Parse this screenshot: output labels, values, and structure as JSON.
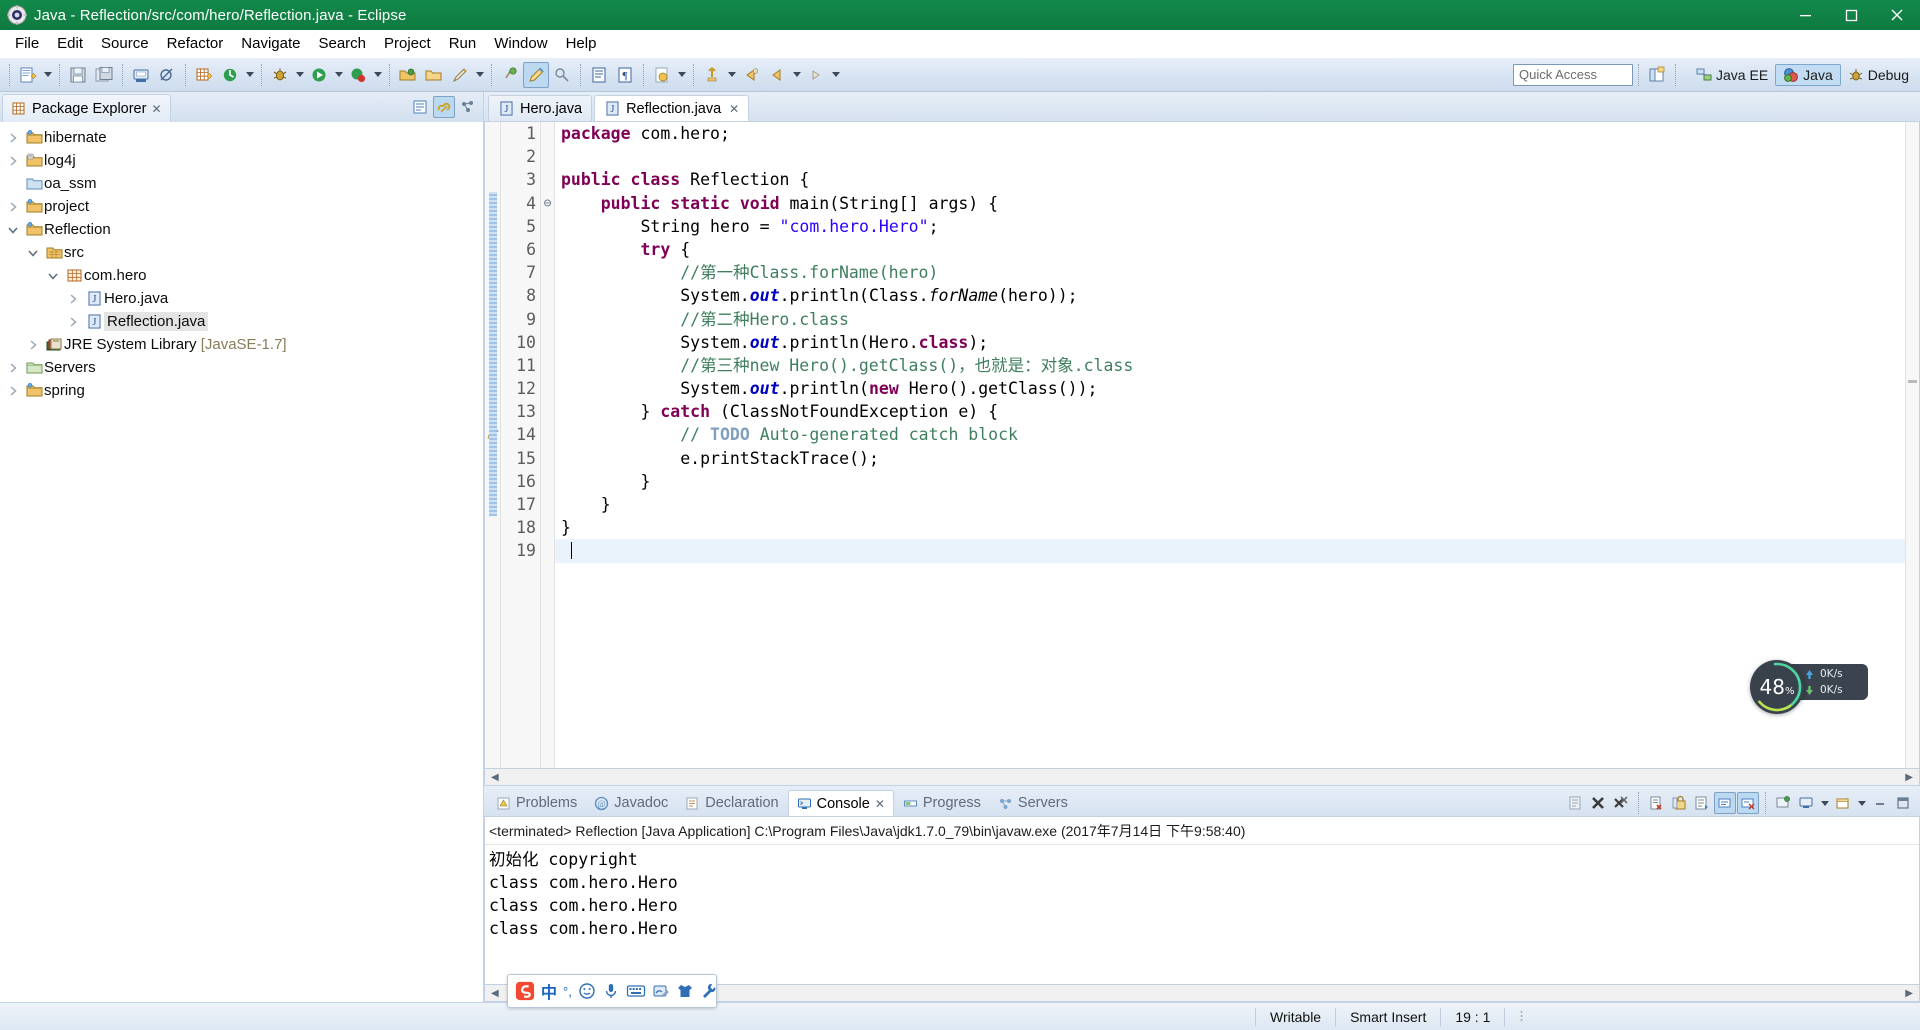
{
  "window": {
    "title": "Java - Reflection/src/com/hero/Reflection.java - Eclipse",
    "app_icon": "eclipse-icon",
    "controls": {
      "minimize": "minimize-icon",
      "maximize": "maximize-icon",
      "close": "close-icon"
    },
    "titlebar_color": "#128a4a"
  },
  "menubar": {
    "items": [
      "File",
      "Edit",
      "Source",
      "Refactor",
      "Navigate",
      "Search",
      "Project",
      "Run",
      "Window",
      "Help"
    ]
  },
  "toolbar": {
    "quick_access_placeholder": "Quick Access",
    "perspectives": [
      {
        "label": "Java EE",
        "selected": false,
        "icon": "java-ee-perspective-icon"
      },
      {
        "label": "Java",
        "selected": true,
        "icon": "java-perspective-icon"
      },
      {
        "label": "Debug",
        "selected": false,
        "icon": "debug-perspective-icon"
      }
    ],
    "open_perspective_icon": "open-perspective-icon",
    "buttons": [
      "new-wizard-icon",
      "new-dropdown",
      "save-icon",
      "save-all-icon",
      "print-icon",
      "toggle-breakpoint-icon",
      "new-java-package-icon",
      "refresh-icon",
      "refresh-dropdown",
      "debug-icon",
      "debug-dropdown",
      "run-icon",
      "run-dropdown",
      "coverage-icon",
      "coverage-dropdown",
      "open-type-icon",
      "open-task-icon",
      "search-icon",
      "search-dropdown",
      "next-annotation-icon",
      "pencil-icon",
      "link-icon",
      "outline-icon",
      "pilcrow-icon",
      "java-element-icon",
      "element-dropdown",
      "back-icon",
      "back-dropdown",
      "prev-edit-icon",
      "next-edit-icon",
      "next-dropdown",
      "forward-icon",
      "forward-dropdown"
    ]
  },
  "package_explorer": {
    "title": "Package Explorer",
    "close_icon": "close-icon",
    "tools": [
      "collapse-all-icon",
      "link-with-editor-icon",
      "view-menu-icon"
    ],
    "tree": [
      {
        "label": "hibernate",
        "indent": 0,
        "twist": "collapsed",
        "icon": "java-project-icon",
        "selected": false
      },
      {
        "label": "log4j",
        "indent": 0,
        "twist": "collapsed",
        "icon": "web-project-icon",
        "selected": false
      },
      {
        "label": "oa_ssm",
        "indent": 0,
        "twist": "none",
        "icon": "closed-folder-icon",
        "selected": false
      },
      {
        "label": "project",
        "indent": 0,
        "twist": "collapsed",
        "icon": "java-project-icon",
        "selected": false
      },
      {
        "label": "Reflection",
        "indent": 0,
        "twist": "expanded",
        "icon": "java-project-icon",
        "selected": false
      },
      {
        "label": "src",
        "indent": 1,
        "twist": "expanded",
        "icon": "source-folder-icon",
        "selected": false
      },
      {
        "label": "com.hero",
        "indent": 2,
        "twist": "expanded",
        "icon": "package-icon",
        "selected": false
      },
      {
        "label": "Hero.java",
        "indent": 3,
        "twist": "collapsed",
        "icon": "java-file-icon",
        "selected": false
      },
      {
        "label": "Reflection.java",
        "indent": 3,
        "twist": "collapsed",
        "icon": "java-file-icon",
        "selected": true
      },
      {
        "label": "JRE System Library ",
        "dim": "[JavaSE-1.7]",
        "indent": 1,
        "twist": "collapsed",
        "icon": "jre-library-icon",
        "selected": false
      },
      {
        "label": "Servers",
        "indent": 0,
        "twist": "collapsed",
        "icon": "servers-folder-icon",
        "selected": false
      },
      {
        "label": "spring",
        "indent": 0,
        "twist": "collapsed",
        "icon": "java-project-icon",
        "selected": false
      }
    ]
  },
  "editor": {
    "tabs": [
      {
        "label": "Hero.java",
        "active": false,
        "icon": "java-file-icon",
        "closable": false
      },
      {
        "label": "Reflection.java",
        "active": true,
        "icon": "java-file-icon",
        "closable": true
      }
    ],
    "current_line": 19,
    "lines": [
      {
        "n": 1,
        "fold": "",
        "marker": "",
        "tokens": [
          {
            "t": "package ",
            "c": "kw"
          },
          {
            "t": "com.hero;",
            "c": ""
          }
        ]
      },
      {
        "n": 2,
        "fold": "",
        "marker": "",
        "tokens": []
      },
      {
        "n": 3,
        "fold": "",
        "marker": "",
        "tokens": [
          {
            "t": "public class ",
            "c": "kw"
          },
          {
            "t": "Reflection {",
            "c": ""
          }
        ]
      },
      {
        "n": 4,
        "fold": "-",
        "marker": "bar",
        "tokens": [
          {
            "t": "    ",
            "c": ""
          },
          {
            "t": "public static void ",
            "c": "kw"
          },
          {
            "t": "main(String[] args) {",
            "c": ""
          }
        ]
      },
      {
        "n": 5,
        "fold": "",
        "marker": "bar",
        "tokens": [
          {
            "t": "        String hero = ",
            "c": ""
          },
          {
            "t": "\"com.hero.Hero\"",
            "c": "str"
          },
          {
            "t": ";",
            "c": ""
          }
        ]
      },
      {
        "n": 6,
        "fold": "",
        "marker": "bar",
        "tokens": [
          {
            "t": "        ",
            "c": ""
          },
          {
            "t": "try",
            "c": "kw"
          },
          {
            "t": " {",
            "c": ""
          }
        ]
      },
      {
        "n": 7,
        "fold": "",
        "marker": "bar",
        "tokens": [
          {
            "t": "            //第一种Class.forName(hero)",
            "c": "cmt"
          }
        ]
      },
      {
        "n": 8,
        "fold": "",
        "marker": "bar",
        "tokens": [
          {
            "t": "            System.",
            "c": ""
          },
          {
            "t": "out",
            "c": "fld"
          },
          {
            "t": ".println(Class.",
            "c": ""
          },
          {
            "t": "forName",
            "c": "stat"
          },
          {
            "t": "(hero));",
            "c": ""
          }
        ]
      },
      {
        "n": 9,
        "fold": "",
        "marker": "bar",
        "tokens": [
          {
            "t": "            //第二种Hero.class",
            "c": "cmt"
          }
        ]
      },
      {
        "n": 10,
        "fold": "",
        "marker": "bar",
        "tokens": [
          {
            "t": "            System.",
            "c": ""
          },
          {
            "t": "out",
            "c": "fld"
          },
          {
            "t": ".println(Hero.",
            "c": ""
          },
          {
            "t": "class",
            "c": "kw"
          },
          {
            "t": ");",
            "c": ""
          }
        ]
      },
      {
        "n": 11,
        "fold": "",
        "marker": "bar",
        "tokens": [
          {
            "t": "            //第三种new Hero().getClass()，也就是：对象.class",
            "c": "cmt"
          }
        ]
      },
      {
        "n": 12,
        "fold": "",
        "marker": "bar",
        "tokens": [
          {
            "t": "            System.",
            "c": ""
          },
          {
            "t": "out",
            "c": "fld"
          },
          {
            "t": ".println(",
            "c": ""
          },
          {
            "t": "new",
            "c": "kw"
          },
          {
            "t": " Hero().getClass());",
            "c": ""
          }
        ]
      },
      {
        "n": 13,
        "fold": "",
        "marker": "bar",
        "tokens": [
          {
            "t": "        } ",
            "c": ""
          },
          {
            "t": "catch",
            "c": "kw"
          },
          {
            "t": " (ClassNotFoundException e) {",
            "c": ""
          }
        ]
      },
      {
        "n": 14,
        "fold": "",
        "marker": "todo",
        "tokens": [
          {
            "t": "            // ",
            "c": "cmt"
          },
          {
            "t": "TODO",
            "c": "tod"
          },
          {
            "t": " Auto-generated catch block",
            "c": "cmt"
          }
        ]
      },
      {
        "n": 15,
        "fold": "",
        "marker": "bar",
        "tokens": [
          {
            "t": "            e.printStackTrace();",
            "c": ""
          }
        ]
      },
      {
        "n": 16,
        "fold": "",
        "marker": "bar",
        "tokens": [
          {
            "t": "        }",
            "c": ""
          }
        ]
      },
      {
        "n": 17,
        "fold": "",
        "marker": "bar",
        "tokens": [
          {
            "t": "    }",
            "c": ""
          }
        ]
      },
      {
        "n": 18,
        "fold": "",
        "marker": "",
        "tokens": [
          {
            "t": "}",
            "c": ""
          }
        ]
      },
      {
        "n": 19,
        "fold": "",
        "marker": "",
        "tokens": [],
        "current": true
      }
    ]
  },
  "console": {
    "tabs": [
      {
        "label": "Problems",
        "active": false,
        "icon": "problems-icon",
        "closable": false
      },
      {
        "label": "Javadoc",
        "active": false,
        "icon": "javadoc-icon",
        "closable": false
      },
      {
        "label": "Declaration",
        "active": false,
        "icon": "declaration-icon",
        "closable": false
      },
      {
        "label": "Console",
        "active": true,
        "icon": "console-icon",
        "closable": true
      },
      {
        "label": "Progress",
        "active": false,
        "icon": "progress-icon",
        "closable": false
      },
      {
        "label": "Servers",
        "active": false,
        "icon": "servers-icon",
        "closable": false
      }
    ],
    "header": "<terminated> Reflection [Java Application] C:\\Program Files\\Java\\jdk1.7.0_79\\bin\\javaw.exe (2017年7月14日 下午9:58:40)",
    "output": [
      "初始化 copyright",
      "class com.hero.Hero",
      "class com.hero.Hero",
      "class com.hero.Hero"
    ],
    "tools": [
      "clear-console-icon",
      "terminate-icon",
      "remove-all-terminated-icon",
      "show-console-on-output-icon",
      "lock-scroll-icon",
      "word-wrap-icon",
      "scroll-lock-icon",
      "pin-console-icon",
      "display-selected-console-icon",
      "open-console-icon",
      "open-console-dropdown",
      "minimize-icon",
      "maximize-icon"
    ]
  },
  "statusbar": {
    "writable": "Writable",
    "insert_mode": "Smart Insert",
    "cursor_position": "19 : 1"
  },
  "speed_widget": {
    "percent": "48",
    "percent_suffix": "%",
    "upload": "0K/s",
    "download": "0K/s",
    "upload_icon": "upload-arrow-icon",
    "download_icon": "download-arrow-icon"
  },
  "ime_bar": {
    "logo": "sogou-logo-icon",
    "mode": "中",
    "punct": "°,",
    "items": [
      "smiley-icon",
      "microphone-icon",
      "soft-keyboard-icon",
      "handwriting-icon",
      "skin-icon",
      "toolbox-icon"
    ]
  }
}
